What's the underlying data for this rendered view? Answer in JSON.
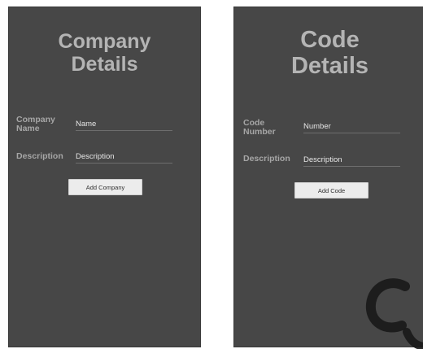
{
  "company_screen": {
    "title_line1": "Company",
    "title_line2": "Details",
    "name_label": "Company Name",
    "name_placeholder": "Name",
    "description_label": "Description",
    "description_placeholder": "Description",
    "add_button": "Add Company"
  },
  "code_screen": {
    "title_line1": "Code",
    "title_line2": "Details",
    "number_label": "Code Number",
    "number_placeholder": "Number",
    "description_label": "Description",
    "description_placeholder": "Description",
    "add_button": "Add Code"
  },
  "colors": {
    "screen_background": "#474747",
    "title_text": "#b4b4b4",
    "label_text": "#a6a6a6",
    "button_background": "#ececec"
  }
}
